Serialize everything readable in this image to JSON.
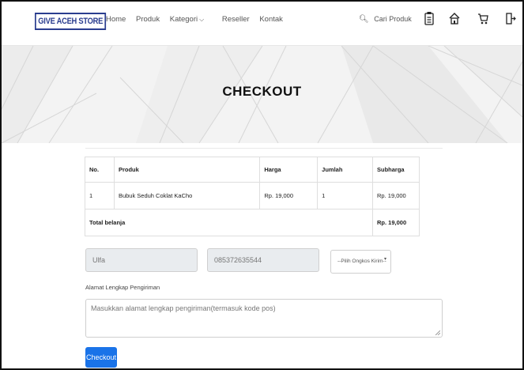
{
  "nav": {
    "brand": "GIVE ACEH STORE",
    "links": {
      "home": "Home",
      "produk": "Produk",
      "kategori": "Kategori",
      "reseller": "Reseller",
      "kontak": "Kontak"
    },
    "search_label": "Cari Produk"
  },
  "hero": {
    "title": "CHECKOUT"
  },
  "table": {
    "headers": {
      "no": "No.",
      "produk": "Produk",
      "harga": "Harga",
      "jumlah": "Jumlah",
      "subharga": "Subharga"
    },
    "rows": [
      {
        "no": "1",
        "produk": "Bubuk Seduh Coklat KaCho",
        "harga": "Rp. 19,000",
        "jumlah": "1",
        "subharga": "Rp. 19,000"
      }
    ],
    "total_label": "Total belanja",
    "total_value": "Rp. 19,000"
  },
  "form": {
    "name_value": "Ulfa",
    "phone_value": "085372635544",
    "ongkir_selected": "--Pilih Ongkos Kirim--",
    "address_label": "Alamat Lengkap Pengiriman",
    "address_placeholder": "Masukkan alamat lengkap pengiriman(termasuk kode pos)",
    "submit_label": "Checkout"
  },
  "colors": {
    "brand": "#2a3d8f",
    "button": "#1a73e8"
  }
}
